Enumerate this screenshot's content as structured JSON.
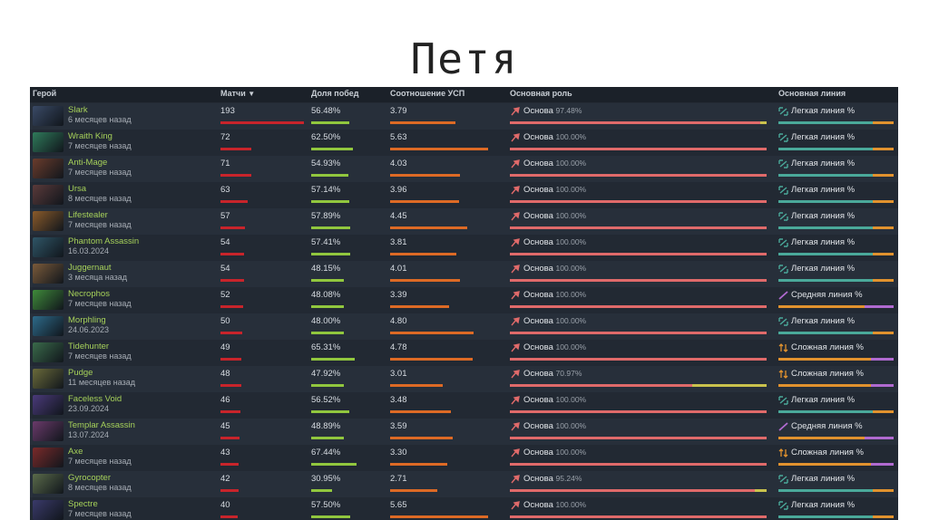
{
  "title": "Петя",
  "columns": {
    "hero": "Герой",
    "matches": "Матчи",
    "winrate": "Доля побед",
    "kda": "Соотношение УСП",
    "role": "Основная роль",
    "lane": "Основная линия"
  },
  "sort_icon": "triangle-down-icon",
  "colors": {
    "matches_bar": "#c8242b",
    "winrate_bar": "#91c73e",
    "kda_bar": "#dd6a25",
    "role_bar": "#e06a6a",
    "role_bar_rest": "#c9c24d",
    "lane_safe": "#4aa99a",
    "lane_mid": "#b06ad0",
    "lane_off": "#e1922e",
    "hero_name": "#a6d15a"
  },
  "rows": [
    {
      "hero": "Slark",
      "date": "6 месяцев назад",
      "matches": "193",
      "winrate": "56.48%",
      "kda": "3.79",
      "role": "Основа",
      "role_pct": "97.48%",
      "lane": "Легкая линия %",
      "lane_type": "safe",
      "avatar": "#3a4a66",
      "m": 193,
      "w": 56.48,
      "k": 3.79,
      "rp": 97.48
    },
    {
      "hero": "Wraith King",
      "date": "7 месяцев назад",
      "matches": "72",
      "winrate": "62.50%",
      "kda": "5.63",
      "role": "Основа",
      "role_pct": "100.00%",
      "lane": "Легкая линия %",
      "lane_type": "safe",
      "avatar": "#2f7a5a",
      "m": 72,
      "w": 62.5,
      "k": 5.63,
      "rp": 100
    },
    {
      "hero": "Anti-Mage",
      "date": "7 месяцев назад",
      "matches": "71",
      "winrate": "54.93%",
      "kda": "4.03",
      "role": "Основа",
      "role_pct": "100.00%",
      "lane": "Легкая линия %",
      "lane_type": "safe",
      "avatar": "#6a3c2c",
      "m": 71,
      "w": 54.93,
      "k": 4.03,
      "rp": 100
    },
    {
      "hero": "Ursa",
      "date": "8 месяцев назад",
      "matches": "63",
      "winrate": "57.14%",
      "kda": "3.96",
      "role": "Основа",
      "role_pct": "100.00%",
      "lane": "Легкая линия %",
      "lane_type": "safe",
      "avatar": "#5a3a3a",
      "m": 63,
      "w": 57.14,
      "k": 3.96,
      "rp": 100
    },
    {
      "hero": "Lifestealer",
      "date": "7 месяцев назад",
      "matches": "57",
      "winrate": "57.89%",
      "kda": "4.45",
      "role": "Основа",
      "role_pct": "100.00%",
      "lane": "Легкая линия %",
      "lane_type": "safe",
      "avatar": "#8a5a2a",
      "m": 57,
      "w": 57.89,
      "k": 4.45,
      "rp": 100
    },
    {
      "hero": "Phantom Assassin",
      "date": "16.03.2024",
      "matches": "54",
      "winrate": "57.41%",
      "kda": "3.81",
      "role": "Основа",
      "role_pct": "100.00%",
      "lane": "Легкая линия %",
      "lane_type": "safe",
      "avatar": "#2f5566",
      "m": 54,
      "w": 57.41,
      "k": 3.81,
      "rp": 100
    },
    {
      "hero": "Juggernaut",
      "date": "3 месяца назад",
      "matches": "54",
      "winrate": "48.15%",
      "kda": "4.01",
      "role": "Основа",
      "role_pct": "100.00%",
      "lane": "Легкая линия %",
      "lane_type": "safe",
      "avatar": "#7a5a3a",
      "m": 54,
      "w": 48.15,
      "k": 4.01,
      "rp": 100
    },
    {
      "hero": "Necrophos",
      "date": "7 месяцев назад",
      "matches": "52",
      "winrate": "48.08%",
      "kda": "3.39",
      "role": "Основа",
      "role_pct": "100.00%",
      "lane": "Средняя линия %",
      "lane_type": "mid",
      "avatar": "#3f8a3a",
      "m": 52,
      "w": 48.08,
      "k": 3.39,
      "rp": 100
    },
    {
      "hero": "Morphling",
      "date": "24.06.2023",
      "matches": "50",
      "winrate": "48.00%",
      "kda": "4.80",
      "role": "Основа",
      "role_pct": "100.00%",
      "lane": "Легкая линия %",
      "lane_type": "safe",
      "avatar": "#2d6a8a",
      "m": 50,
      "w": 48.0,
      "k": 4.8,
      "rp": 100
    },
    {
      "hero": "Tidehunter",
      "date": "7 месяцев назад",
      "matches": "49",
      "winrate": "65.31%",
      "kda": "4.78",
      "role": "Основа",
      "role_pct": "100.00%",
      "lane": "Сложная линия %",
      "lane_type": "off",
      "avatar": "#3a6a4a",
      "m": 49,
      "w": 65.31,
      "k": 4.78,
      "rp": 100
    },
    {
      "hero": "Pudge",
      "date": "11 месяцев назад",
      "matches": "48",
      "winrate": "47.92%",
      "kda": "3.01",
      "role": "Основа",
      "role_pct": "70.97%",
      "lane": "Сложная линия %",
      "lane_type": "off",
      "avatar": "#6a6a3a",
      "m": 48,
      "w": 47.92,
      "k": 3.01,
      "rp": 70.97
    },
    {
      "hero": "Faceless Void",
      "date": "23.09.2024",
      "matches": "46",
      "winrate": "56.52%",
      "kda": "3.48",
      "role": "Основа",
      "role_pct": "100.00%",
      "lane": "Легкая линия %",
      "lane_type": "safe",
      "avatar": "#4a3a7a",
      "m": 46,
      "w": 56.52,
      "k": 3.48,
      "rp": 100
    },
    {
      "hero": "Templar Assassin",
      "date": "13.07.2024",
      "matches": "45",
      "winrate": "48.89%",
      "kda": "3.59",
      "role": "Основа",
      "role_pct": "100.00%",
      "lane": "Средняя линия %",
      "lane_type": "mid",
      "avatar": "#6a3a6a",
      "m": 45,
      "w": 48.89,
      "k": 3.59,
      "rp": 100
    },
    {
      "hero": "Axe",
      "date": "7 месяцев назад",
      "matches": "43",
      "winrate": "67.44%",
      "kda": "3.30",
      "role": "Основа",
      "role_pct": "100.00%",
      "lane": "Сложная линия %",
      "lane_type": "off",
      "avatar": "#7a2a2a",
      "m": 43,
      "w": 67.44,
      "k": 3.3,
      "rp": 100
    },
    {
      "hero": "Gyrocopter",
      "date": "8 месяцев назад",
      "matches": "42",
      "winrate": "30.95%",
      "kda": "2.71",
      "role": "Основа",
      "role_pct": "95.24%",
      "lane": "Легкая линия %",
      "lane_type": "safe",
      "avatar": "#5a6a4a",
      "m": 42,
      "w": 30.95,
      "k": 2.71,
      "rp": 95.24
    },
    {
      "hero": "Spectre",
      "date": "7 месяцев назад",
      "matches": "40",
      "winrate": "57.50%",
      "kda": "5.65",
      "role": "Основа",
      "role_pct": "100.00%",
      "lane": "Легкая линия %",
      "lane_type": "safe",
      "avatar": "#3a3a6a",
      "m": 40,
      "w": 57.5,
      "k": 5.65,
      "rp": 100
    }
  ]
}
